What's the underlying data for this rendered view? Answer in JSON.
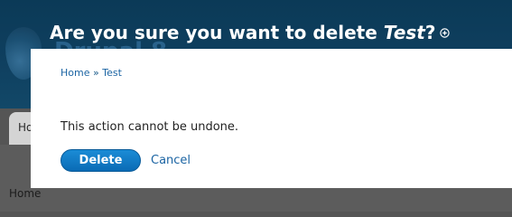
{
  "background": {
    "site_name": "Drupal 8",
    "tab_label": "Ho",
    "breadcrumb": "Home"
  },
  "dialog": {
    "title_prefix": "Are you sure you want to delete ",
    "title_item": "Test",
    "title_suffix": "?",
    "breadcrumb": {
      "home": "Home",
      "separator": " » ",
      "current": "Test"
    },
    "message": "This action cannot be undone.",
    "delete_label": "Delete",
    "cancel_label": "Cancel"
  },
  "colors": {
    "header": "#0f3f5f",
    "accent": "#0a6bb5",
    "link": "#1b64a3"
  },
  "icons": {
    "close": "close-icon"
  }
}
